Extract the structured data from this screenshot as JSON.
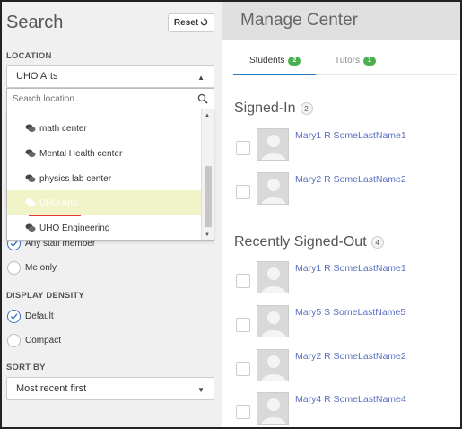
{
  "search_panel": {
    "title": "Search",
    "reset_label": "Reset",
    "location_label": "LOCATION",
    "location_selected": "UHO Arts",
    "search_placeholder": "Search location...",
    "location_options": [
      "math center",
      "Mental Health center",
      "physics lab center",
      "UHO Arts",
      "UHO Engineering"
    ],
    "selected_option_index": 3,
    "staff_options": [
      {
        "label": "Any staff member",
        "checked": true
      },
      {
        "label": "Me only",
        "checked": false
      }
    ],
    "display_density_label": "DISPLAY DENSITY",
    "density_options": [
      {
        "label": "Default",
        "checked": true
      },
      {
        "label": "Compact",
        "checked": false
      }
    ],
    "sort_by_label": "SORT BY",
    "sort_selected": "Most recent first"
  },
  "manage_center": {
    "title": "Manage Center",
    "tabs": [
      {
        "label": "Students",
        "count": "2",
        "active": true
      },
      {
        "label": "Tutors",
        "count": "1",
        "active": false
      }
    ],
    "signed_in": {
      "title": "Signed-In",
      "count": "2",
      "people": [
        "Mary1 R SomeLastName1",
        "Mary2 R SomeLastName2"
      ]
    },
    "signed_out": {
      "title": "Recently Signed-Out",
      "count": "4",
      "people": [
        "Mary1 R SomeLastName1",
        "Mary5 S SomeLastName5",
        "Mary2 R SomeLastName2",
        "Mary4 R SomeLastName4"
      ]
    }
  },
  "colors": {
    "accent": "#2a7fc4",
    "badge_green": "#4caf50",
    "name_link": "#5a6fc0",
    "selected_bg": "#f1f3c8",
    "underline_red": "#e53935"
  }
}
